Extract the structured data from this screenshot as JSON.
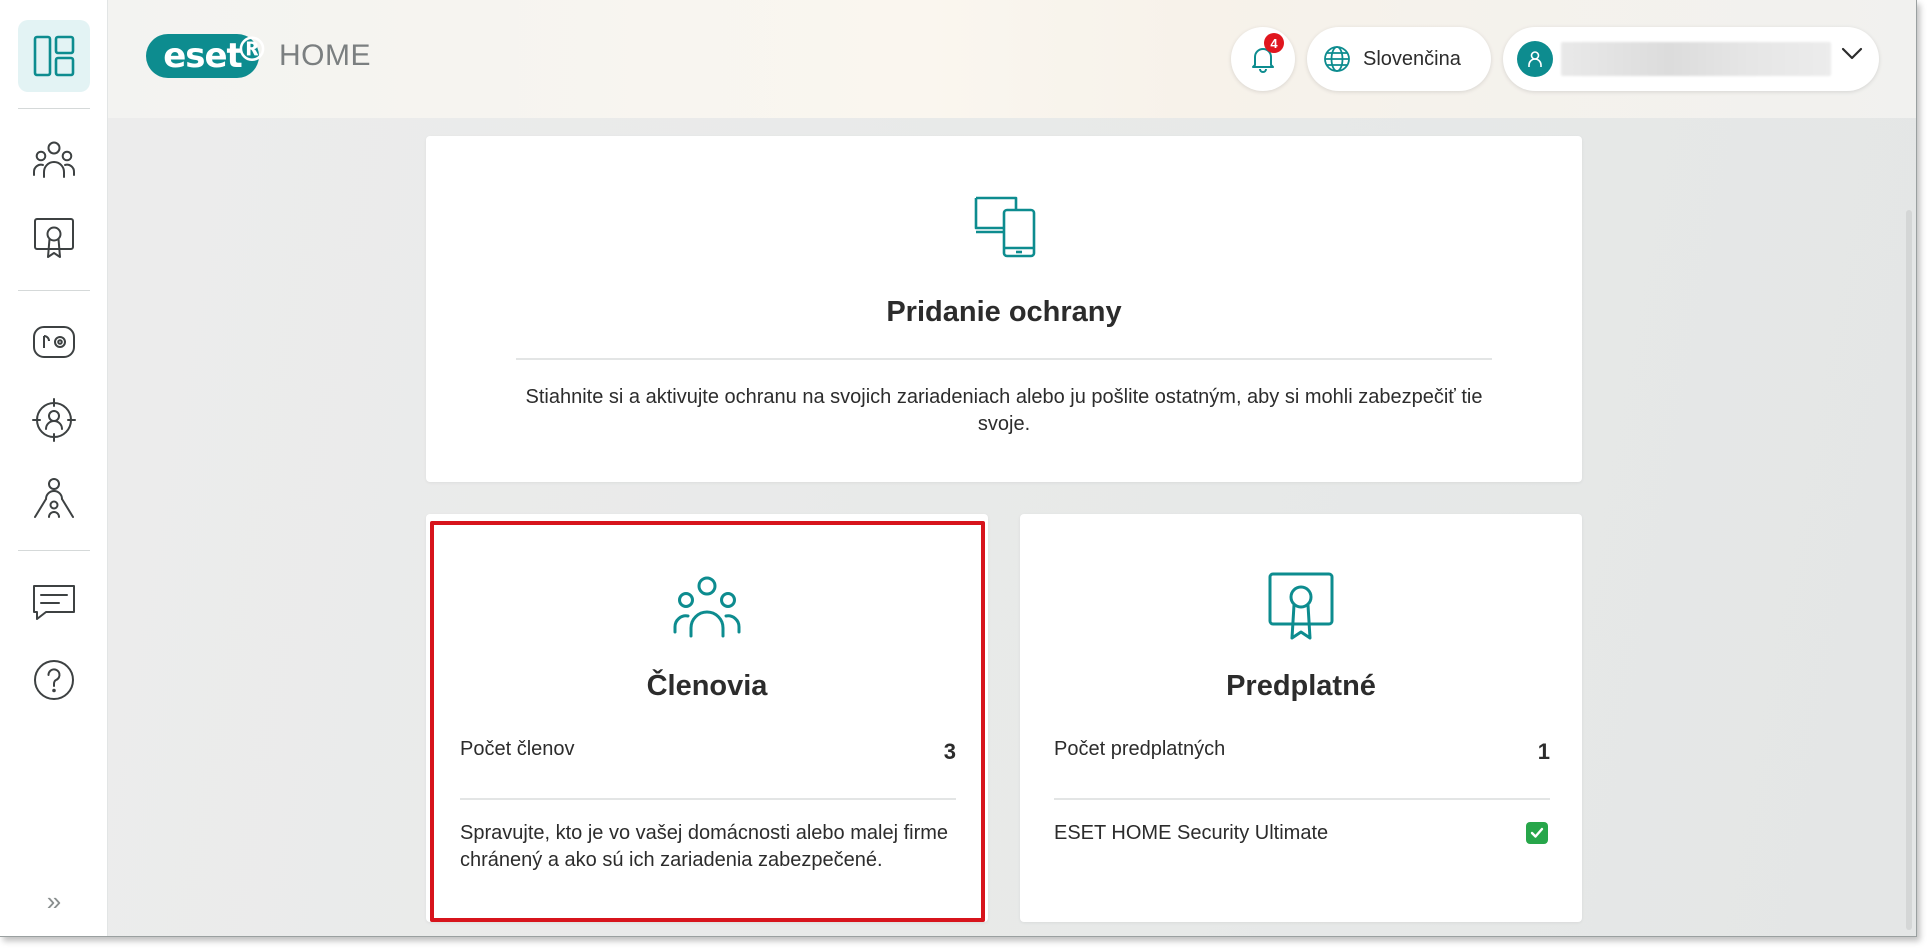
{
  "app": {
    "logo_text": "eset",
    "logo_mark": "®",
    "product": "HOME"
  },
  "sidebar": {
    "items": [
      {
        "name": "dashboard-icon",
        "active": true
      },
      {
        "name": "members-icon"
      },
      {
        "name": "subscription-certificate-icon"
      },
      {
        "name": "device-settings-icon"
      },
      {
        "name": "anti-theft-icon"
      },
      {
        "name": "parental-control-icon"
      },
      {
        "name": "chat-message-icon"
      },
      {
        "name": "help-icon"
      }
    ],
    "expand_glyph": "»"
  },
  "header": {
    "notifications": {
      "count": "4",
      "icon": "bell-icon"
    },
    "language": {
      "label": "Slovenčina",
      "icon": "globe-icon"
    },
    "user": {
      "icon": "person-icon",
      "chevron": "chevron-down-icon"
    }
  },
  "cards": {
    "protection": {
      "title": "Pridanie ochrany",
      "description": "Stiahnite si a aktivujte ochranu na svojich zariadeniach alebo ju pošlite ostatným, aby si mohli zabezpečiť tie svoje.",
      "icon": "devices-icon"
    },
    "members": {
      "title": "Členovia",
      "stat_label": "Počet členov",
      "stat_value": "3",
      "description": "Spravujte, kto je vo vašej domácnosti alebo malej firme chránený a ako sú ich zariadenia zabezpečené.",
      "icon": "members-icon",
      "highlighted": true
    },
    "subscription": {
      "title": "Predplatné",
      "stat_label": "Počet predplatných",
      "stat_value": "1",
      "product_name": "ESET HOME Security Ultimate",
      "product_status": "active",
      "icon": "certificate-icon"
    }
  },
  "colors": {
    "brand": "#0d8c8f",
    "badge_red": "#e0161e",
    "highlight_red": "#d7141c",
    "success_green": "#27a64a"
  }
}
